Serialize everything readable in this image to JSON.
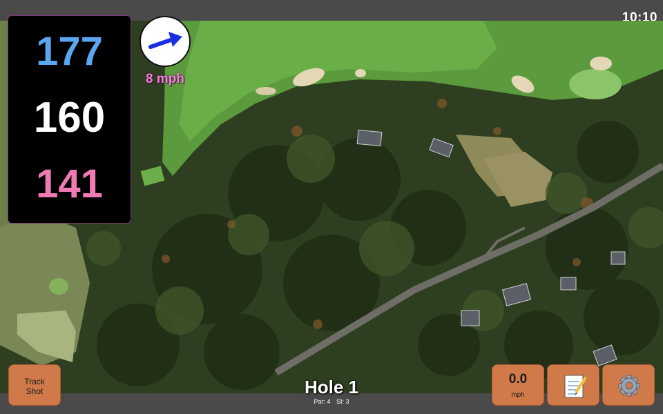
{
  "status": {
    "clock": "10:10"
  },
  "distances": {
    "back": "177",
    "middle": "160",
    "front": "141"
  },
  "wind": {
    "speed": "8 mph",
    "direction_icon": "wind-arrow-icon"
  },
  "buttons": {
    "track_shot_line1": "Track",
    "track_shot_line2": "Shot",
    "speed_value": "0.0",
    "speed_unit": "mph",
    "notes_icon": "notepad-icon",
    "settings_icon": "gear-icon"
  },
  "hole": {
    "title": "Hole 1",
    "par": "Par: 4",
    "si": "SI: 3"
  },
  "colors": {
    "back_distance": "#5aa6ef",
    "middle_distance": "#ffffff",
    "front_distance": "#f07ab4",
    "wind_label": "#f184d2",
    "button_fill": "#d07a4a",
    "bar_background": "#4a4a4a"
  }
}
